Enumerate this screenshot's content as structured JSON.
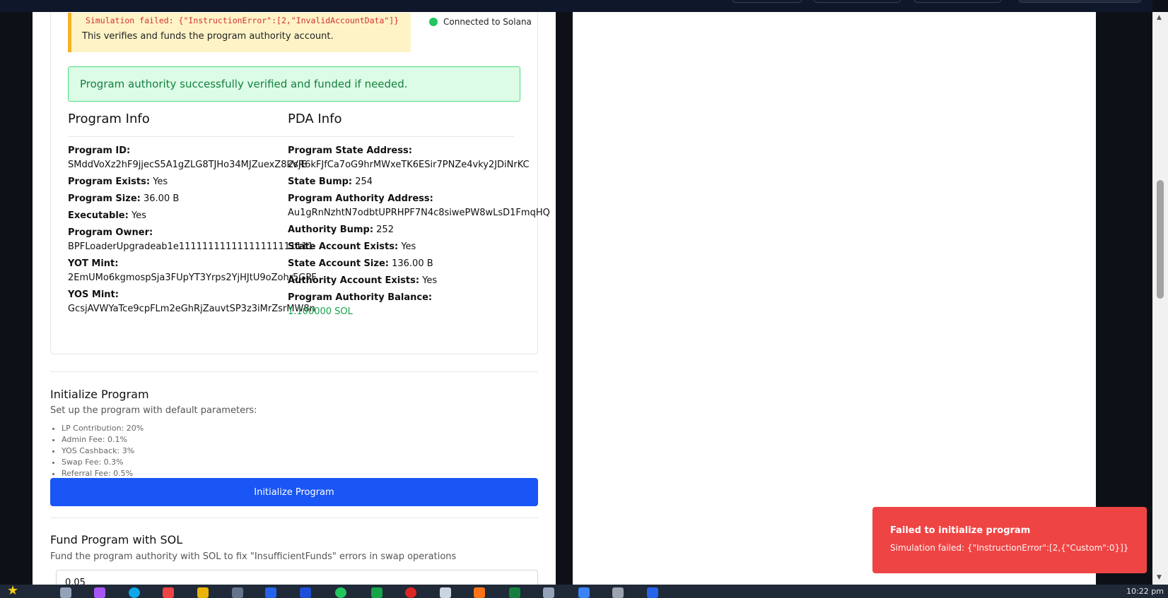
{
  "status": {
    "error_detail": "Simulation failed: {\"InstructionError\":[2,\"InvalidAccountData\"]}",
    "help_text": "This verifies and funds the program authority account.",
    "connection": "Connected to Solana",
    "success": "Program authority successfully verified and funded if needed."
  },
  "program_info": {
    "title": "Program Info",
    "program_id_label": "Program ID:",
    "program_id": "SMddVoXz2hF9jjecS5A1gZLG8TJHo34MJZuexZ8kVjE",
    "exists_label": "Program Exists:",
    "exists": "Yes",
    "size_label": "Program Size:",
    "size": "36.00 B",
    "executable_label": "Executable:",
    "executable": "Yes",
    "owner_label": "Program Owner:",
    "owner": "BPFLoaderUpgradeab1e11111111111111111111111",
    "yot_label": "YOT Mint:",
    "yot": "2EmUMo6kgmospSja3FUpYT3Yrps2YjHJtU9oZohr5GPF",
    "yos_label": "YOS Mint:",
    "yos": "GcsjAVWYaTce9cpFLm2eGhRjZauvtSP3z3iMrZsrMW8n"
  },
  "pda_info": {
    "title": "PDA Info",
    "state_address_label": "Program State Address:",
    "state_address": "2sR6kFJfCa7oG9hrMWxeTK6ESir7PNZe4vky2JDiNrKC",
    "state_bump_label": "State Bump:",
    "state_bump": "254",
    "authority_address_label": "Program Authority Address:",
    "authority_address": "Au1gRnNzhtN7odbtUPRHPF7N4c8siwePW8wLsD1FmqHQ",
    "authority_bump_label": "Authority Bump:",
    "authority_bump": "252",
    "state_exists_label": "State Account Exists:",
    "state_exists": "Yes",
    "state_size_label": "State Account Size:",
    "state_size": "136.00 B",
    "authority_exists_label": "Authority Account Exists:",
    "authority_exists": "Yes",
    "authority_balance_label": "Program Authority Balance:",
    "authority_balance": "1.100000 SOL"
  },
  "initialize": {
    "title": "Initialize Program",
    "description": "Set up the program with default parameters:",
    "params": [
      "LP Contribution: 20%",
      "Admin Fee: 0.1%",
      "YOS Cashback: 3%",
      "Swap Fee: 0.3%",
      "Referral Fee: 0.5%"
    ],
    "button": "Initialize Program"
  },
  "fund": {
    "title": "Fund Program with SOL",
    "description": "Fund the program authority with SOL to fix \"InsufficientFunds\" errors in swap operations",
    "amount": "0.05"
  },
  "toast": {
    "title": "Failed to initialize program",
    "message": "Simulation failed: {\"InstructionError\":[2,{\"Custom\":0}]}"
  },
  "taskbar": {
    "clock": "10:22 pm"
  },
  "colors": {
    "primary": "#1a56f5",
    "success_bg": "#dcfce7",
    "success_text": "#15803d",
    "warning_bg": "#fdf3c7",
    "warning_border": "#f5b423",
    "error": "#ef4444",
    "connected": "#22c55e"
  }
}
